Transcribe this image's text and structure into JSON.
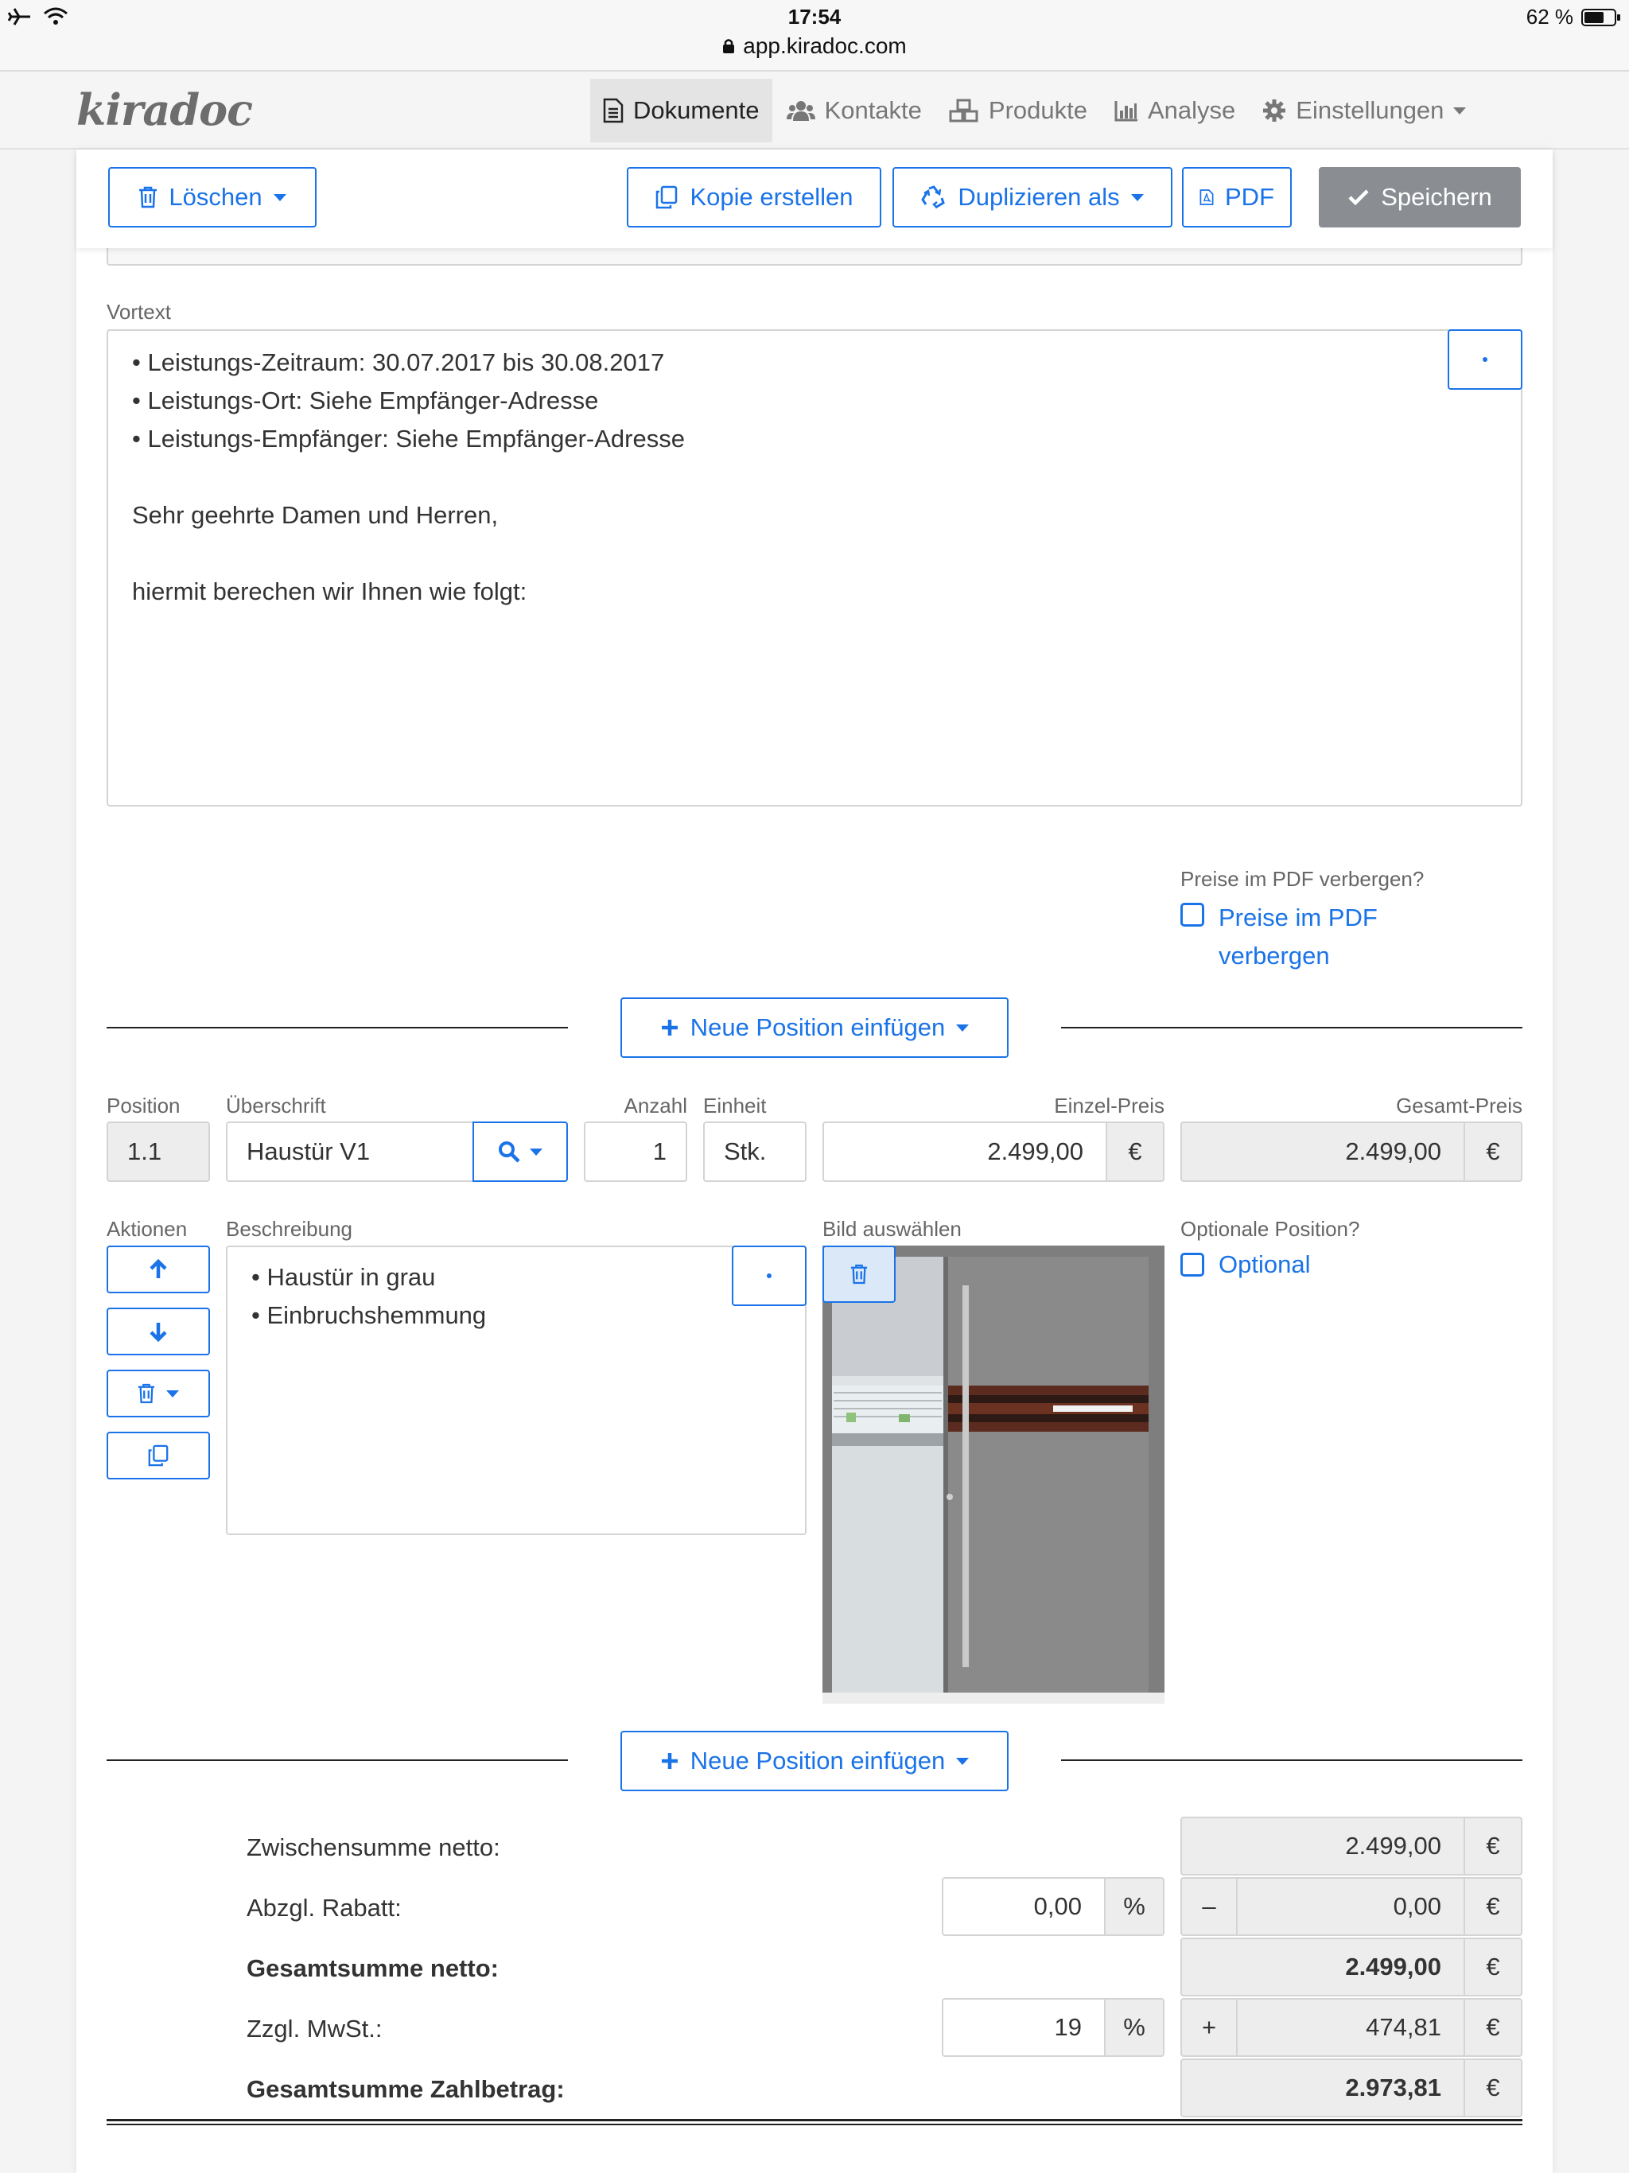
{
  "statusbar": {
    "time": "17:54",
    "url": "app.kiradoc.com",
    "battery": "62 %"
  },
  "brand": "kiradoc",
  "nav": [
    {
      "label": "Dokumente",
      "icon": "document-icon",
      "active": true
    },
    {
      "label": "Kontakte",
      "icon": "users-icon"
    },
    {
      "label": "Produkte",
      "icon": "cubes-icon"
    },
    {
      "label": "Analyse",
      "icon": "bar-chart-icon"
    },
    {
      "label": "Einstellungen",
      "icon": "gear-icon"
    }
  ],
  "toolbar": {
    "delete_label": "Löschen",
    "copy_label": "Kopie erstellen",
    "duplicate_label": "Duplizieren als",
    "pdf_label": "PDF",
    "save_label": "Speichern"
  },
  "vortext": {
    "label": "Vortext",
    "lines": [
      "• Leistungs-Zeitraum: 30.07.2017 bis 30.08.2017",
      "• Leistungs-Ort: Siehe Empfänger-Adresse",
      "• Leistungs-Empfänger: Siehe Empfänger-Adresse",
      "",
      "Sehr geehrte Damen und Herren,",
      "",
      "hiermit berechen wir Ihnen wie folgt:"
    ]
  },
  "hide_prices": {
    "label": "Preise im PDF verbergen?",
    "checkbox_label_line1": "Preise im PDF",
    "checkbox_label_line2": "verbergen",
    "checked": false
  },
  "insert_position_label": "Neue Position einfügen",
  "position": {
    "labels": {
      "position": "Position",
      "heading": "Überschrift",
      "quantity": "Anzahl",
      "unit": "Einheit",
      "unit_price": "Einzel-Preis",
      "total_price": "Gesamt-Preis",
      "actions": "Aktionen",
      "description": "Beschreibung",
      "image": "Bild auswählen",
      "optional": "Optionale Position?"
    },
    "number": "1.1",
    "heading": "Haustür V1",
    "quantity": "1",
    "unit": "Stk.",
    "unit_price": "2.499,00",
    "total_price": "2.499,00",
    "currency": "€",
    "description_lines": [
      "• Haustür in grau",
      "• Einbruchshemmung"
    ],
    "optional_label": "Optional",
    "optional_checked": false
  },
  "totals": {
    "subtotal_label": "Zwischensumme netto:",
    "subtotal": "2.499,00",
    "discount_label": "Abzgl. Rabatt:",
    "discount_percent": "0,00",
    "discount_sign": "–",
    "discount_amount": "0,00",
    "net_total_label": "Gesamtsumme netto:",
    "net_total": "2.499,00",
    "vat_label": "Zzgl. MwSt.:",
    "vat_percent": "19",
    "vat_sign": "+",
    "vat_amount": "474,81",
    "grand_total_label": "Gesamtsumme Zahlbetrag:",
    "grand_total": "2.973,81",
    "percent_symbol": "%",
    "currency": "€"
  },
  "colors": {
    "accent": "#1a73e8",
    "save_button": "#8a8e93",
    "readonly_bg": "#ededed"
  }
}
